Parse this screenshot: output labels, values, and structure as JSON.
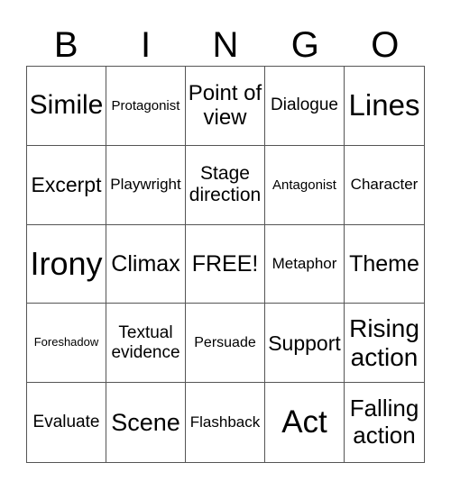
{
  "title_letters": [
    "B",
    "I",
    "N",
    "G",
    "O"
  ],
  "cells": [
    {
      "text": "Simile",
      "size": "30"
    },
    {
      "text": "Protagonist",
      "size": "15"
    },
    {
      "text": "Point of view",
      "size": "24"
    },
    {
      "text": "Dialogue",
      "size": "19"
    },
    {
      "text": "Lines",
      "size": "33"
    },
    {
      "text": "Excerpt",
      "size": "23"
    },
    {
      "text": "Playwright",
      "size": "17"
    },
    {
      "text": "Stage direction",
      "size": "21"
    },
    {
      "text": "Antagonist",
      "size": "15"
    },
    {
      "text": "Character",
      "size": "17"
    },
    {
      "text": "Irony",
      "size": "36"
    },
    {
      "text": "Climax",
      "size": "25"
    },
    {
      "text": "FREE!",
      "size": "25"
    },
    {
      "text": "Metaphor",
      "size": "17"
    },
    {
      "text": "Theme",
      "size": "25"
    },
    {
      "text": "Foreshadow",
      "size": "13"
    },
    {
      "text": "Textual evidence",
      "size": "19"
    },
    {
      "text": "Persuade",
      "size": "16"
    },
    {
      "text": "Support",
      "size": "23"
    },
    {
      "text": "Rising action",
      "size": "28"
    },
    {
      "text": "Evaluate",
      "size": "19"
    },
    {
      "text": "Scene",
      "size": "27"
    },
    {
      "text": "Flashback",
      "size": "17"
    },
    {
      "text": "Act",
      "size": "35"
    },
    {
      "text": "Falling action",
      "size": "26"
    }
  ]
}
